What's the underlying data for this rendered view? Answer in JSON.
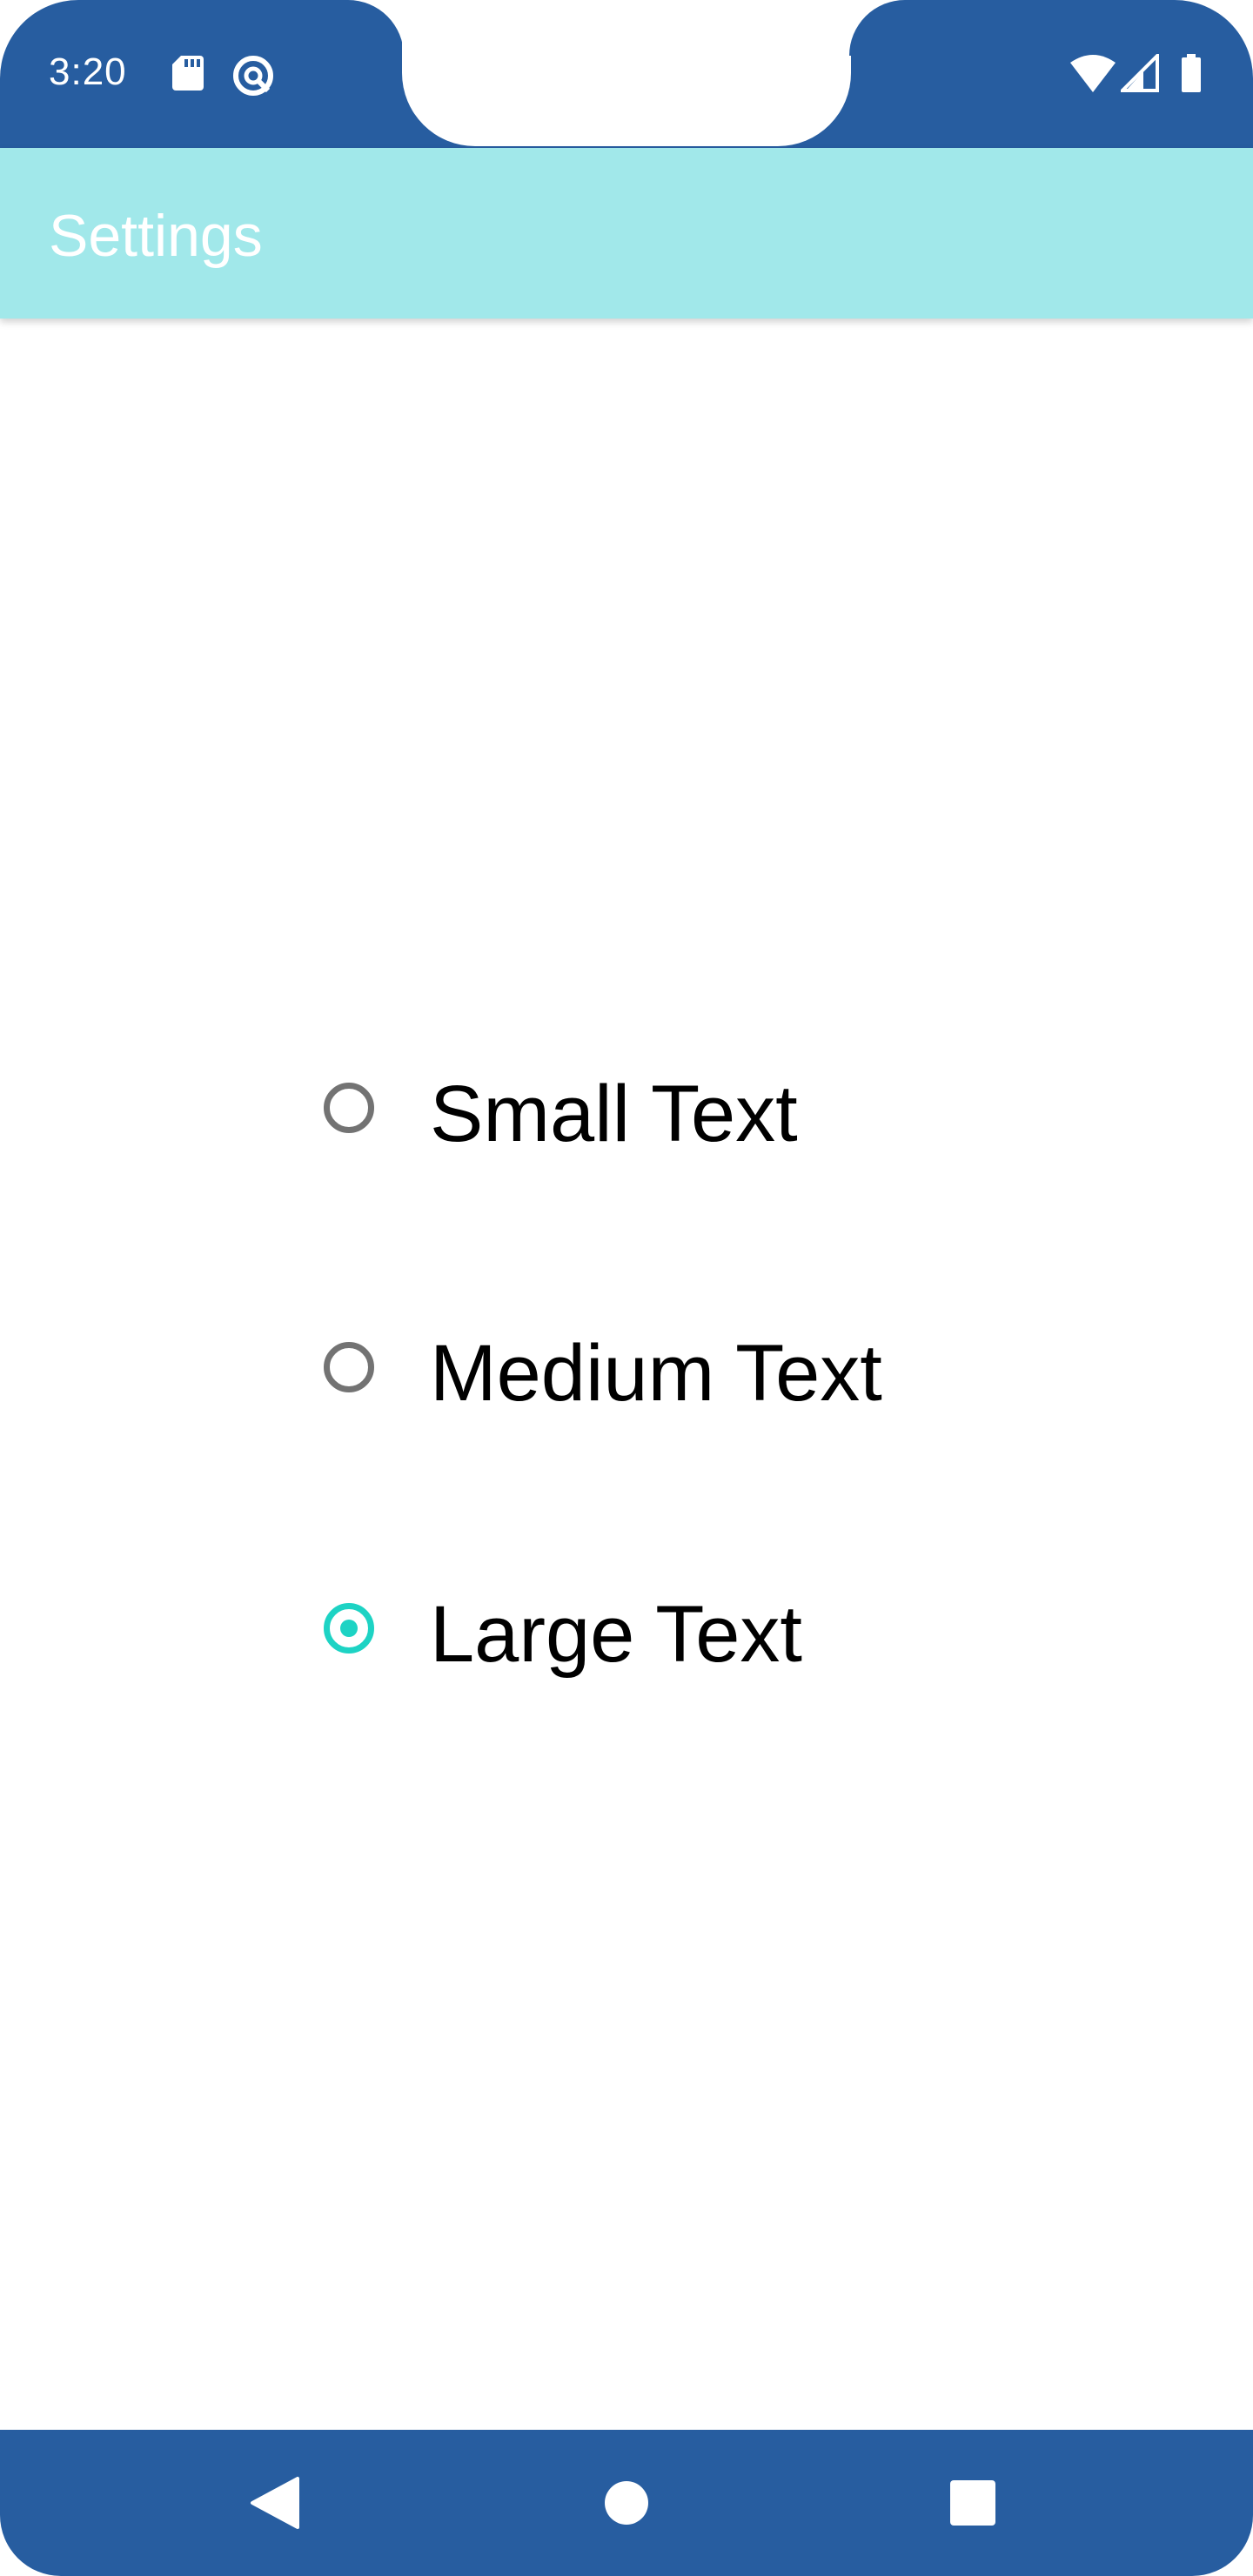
{
  "status_bar": {
    "time": "3:20",
    "icons": [
      "sd-card-icon",
      "data-saver-icon",
      "wifi-icon",
      "signal-icon",
      "battery-icon"
    ]
  },
  "app_bar": {
    "title": "Settings"
  },
  "radio_group": {
    "options": [
      {
        "label": "Small Text",
        "checked": false
      },
      {
        "label": "Medium Text",
        "checked": false
      },
      {
        "label": "Large Text",
        "checked": true
      }
    ]
  },
  "nav_bar": {
    "buttons": [
      "back-icon",
      "home-icon",
      "recents-icon"
    ]
  },
  "colors": {
    "status_bar": "#275da0",
    "app_bar": "#a1e8ea",
    "accent": "#1dd3c4",
    "unchecked": "#737373"
  }
}
